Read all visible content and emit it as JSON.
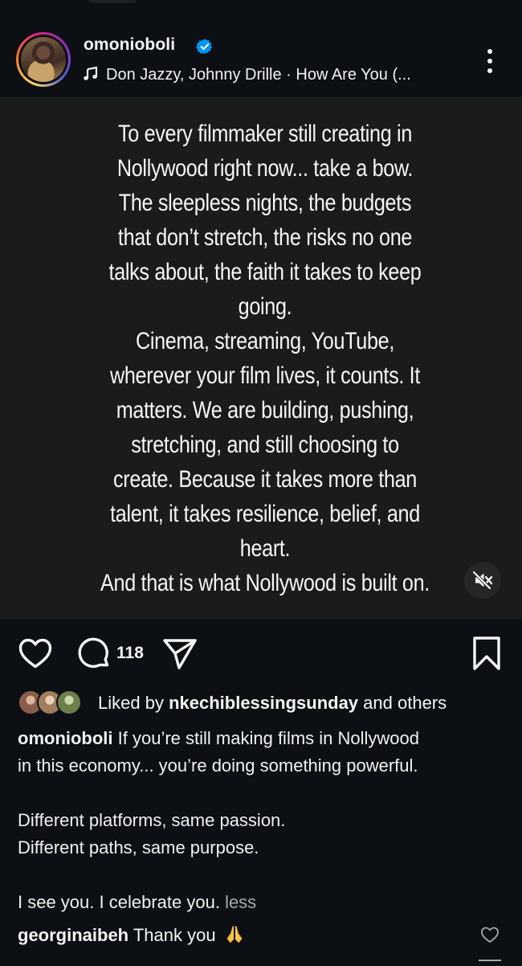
{
  "post": {
    "username": "omonioboli",
    "music": "Don Jazzy, Johnny Drille · How Are You (...",
    "quote_lines": [
      "To every filmmaker still creating in",
      "Nollywood right now... take a bow.",
      "The sleepless nights, the budgets",
      "that don’t stretch, the risks no one",
      "talks about, the faith it takes to keep",
      "going.",
      "Cinema, streaming, YouTube,",
      "wherever your film lives, it counts. It",
      "matters. We are building, pushing,",
      "stretching, and still choosing to",
      "create. Because it takes more than",
      "talent, it takes resilience, belief, and",
      "heart.",
      "And that is what Nollywood is built on."
    ]
  },
  "actions": {
    "comment_count": "118"
  },
  "likes": {
    "prefix": "Liked by",
    "user": "nkechiblessingsunday",
    "suffix": "and others"
  },
  "caption": {
    "username": "omonioboli",
    "line1": "If you’re still making films in Nollywood",
    "line2": "in this economy... you’re doing something powerful.",
    "line3": "Different platforms, same passion.",
    "line4": "Different paths, same purpose.",
    "line5": "I see you. I celebrate you.",
    "less": "less"
  },
  "comment": {
    "username": "georginaibeh",
    "text": "Thank you"
  },
  "icons": {
    "verified": "verified-badge-icon",
    "music": "music-note-icon",
    "more": "more-options-icon",
    "mute": "muted-speaker-icon",
    "like": "heart-icon",
    "comment": "comment-bubble-icon",
    "share": "send-paper-plane-icon",
    "save": "bookmark-icon",
    "pray": "praying-hands-emoji-icon"
  },
  "colors": {
    "background": "#0c1014",
    "media_background": "#1b1b1b",
    "verified_blue": "#0095f6",
    "muted_text": "#a8a8a8"
  }
}
